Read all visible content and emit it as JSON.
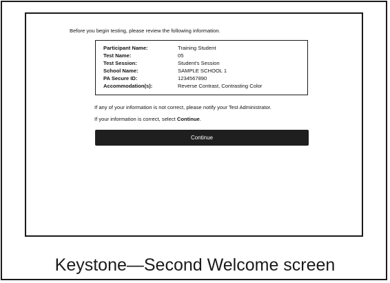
{
  "intro": "Before you begin testing, please review the following information.",
  "info_rows": [
    {
      "label": "Participant Name:",
      "value": "Training Student"
    },
    {
      "label": "Test Name:",
      "value": "05"
    },
    {
      "label": "Test Session:",
      "value": "Student's Session"
    },
    {
      "label": "School Name:",
      "value": "SAMPLE SCHOOL 1"
    },
    {
      "label": "PA Secure ID:",
      "value": "1234567890"
    },
    {
      "label": "Accommodation(s):",
      "value": "Reverse Contrast, Contrasting Color"
    }
  ],
  "notify_text": "If any of your information is not correct, please notify your Test Administrator.",
  "select_prefix": "If your information is correct, select ",
  "select_bold": "Continue",
  "select_suffix": ".",
  "continue_label": "Continue",
  "caption": "Keystone—Second Welcome screen",
  "colors": {
    "button_bg": "#1f1f1f",
    "button_text": "#ffffff",
    "border": "#1a1a1a"
  }
}
